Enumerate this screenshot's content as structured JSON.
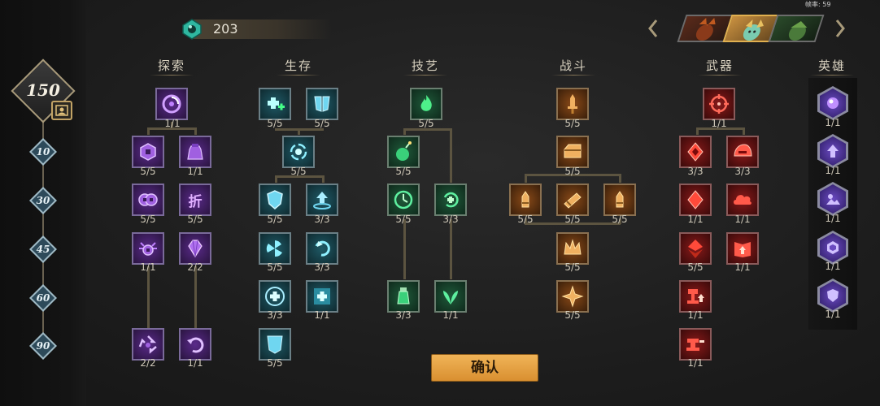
{
  "currency": {
    "icon": "gem-icon",
    "value": "203"
  },
  "fps_label": "帧率: 59",
  "player_level": "150",
  "level_milestones": [
    "10",
    "30",
    "45",
    "60",
    "90"
  ],
  "columns": [
    {
      "id": "explore",
      "title": "探索"
    },
    {
      "id": "survive",
      "title": "生存"
    },
    {
      "id": "craft",
      "title": "技艺"
    },
    {
      "id": "combat",
      "title": "战斗"
    },
    {
      "id": "weapon",
      "title": "武器"
    },
    {
      "id": "hero",
      "title": "英雄"
    }
  ],
  "nodes": {
    "explore_1": {
      "icon": "vortex-icon",
      "count": "1/1",
      "color": "purple"
    },
    "explore_2a": {
      "icon": "coin-icon",
      "count": "5/5",
      "color": "purple"
    },
    "explore_2b": {
      "icon": "bag-icon",
      "count": "1/1",
      "color": "purple"
    },
    "explore_3a": {
      "icon": "coins-icon",
      "count": "5/5",
      "color": "purple"
    },
    "explore_3b": {
      "icon": "discount-icon",
      "count": "5/5",
      "color": "purple",
      "glyph": "折"
    },
    "explore_4a": {
      "icon": "coin-rays-icon",
      "count": "1/1",
      "color": "purple"
    },
    "explore_4b": {
      "icon": "crystal-icon",
      "count": "2/2",
      "color": "purple"
    },
    "explore_5a": {
      "icon": "recycle-icon",
      "count": "2/2",
      "color": "purple"
    },
    "explore_5b": {
      "icon": "return-icon",
      "count": "1/1",
      "color": "purple"
    },
    "survive_1a": {
      "icon": "heal-plus-icon",
      "count": "5/5",
      "color": "teal"
    },
    "survive_1b": {
      "icon": "armor-icon",
      "count": "5/5",
      "color": "teal"
    },
    "survive_2": {
      "icon": "regen-icon",
      "count": "5/5",
      "color": "teal"
    },
    "survive_3a": {
      "icon": "shield-icon",
      "count": "5/5",
      "color": "teal"
    },
    "survive_3b": {
      "icon": "heal-up-icon",
      "count": "3/3",
      "color": "teal"
    },
    "survive_4a": {
      "icon": "spin-icon",
      "count": "5/5",
      "color": "teal"
    },
    "survive_4b": {
      "icon": "swirl-icon",
      "count": "3/3",
      "color": "teal"
    },
    "survive_5a": {
      "icon": "heal-circle-icon",
      "count": "3/3",
      "color": "teal"
    },
    "survive_5b": {
      "icon": "heal-box-icon",
      "count": "1/1",
      "color": "teal"
    },
    "survive_6": {
      "icon": "banner-icon",
      "count": "5/5",
      "color": "teal"
    },
    "craft_1": {
      "icon": "flame-icon",
      "count": "5/5",
      "color": "green"
    },
    "craft_2a": {
      "icon": "bomb-icon",
      "count": "5/5",
      "color": "green"
    },
    "craft_3a": {
      "icon": "clock-icon",
      "count": "5/5",
      "color": "green"
    },
    "craft_3b": {
      "icon": "heal-spin-icon",
      "count": "3/3",
      "color": "green"
    },
    "craft_4a": {
      "icon": "potion-icon",
      "count": "3/3",
      "color": "green"
    },
    "craft_4b": {
      "icon": "leaf-icon",
      "count": "1/1",
      "color": "green"
    },
    "combat_1": {
      "icon": "sword-icon",
      "count": "5/5",
      "color": "orange"
    },
    "combat_2": {
      "icon": "chest-icon",
      "count": "5/5",
      "color": "orange"
    },
    "combat_3a": {
      "icon": "bullet-icon",
      "count": "5/5",
      "color": "orange"
    },
    "combat_3b": {
      "icon": "ammo-icon",
      "count": "5/5",
      "color": "orange"
    },
    "combat_3c": {
      "icon": "bullet-icon",
      "count": "5/5",
      "color": "orange"
    },
    "combat_4": {
      "icon": "crown-icon",
      "count": "5/5",
      "color": "orange"
    },
    "combat_5": {
      "icon": "star-icon",
      "count": "5/5",
      "color": "orange"
    },
    "weapon_1": {
      "icon": "crosshair-icon",
      "count": "1/1",
      "color": "red"
    },
    "weapon_2a": {
      "icon": "gem-red-icon",
      "count": "3/3",
      "color": "red"
    },
    "weapon_2b": {
      "icon": "helmet-icon",
      "count": "3/3",
      "color": "red"
    },
    "weapon_3a": {
      "icon": "diamond-icon",
      "count": "1/1",
      "color": "red"
    },
    "weapon_3b": {
      "icon": "cloud-icon",
      "count": "1/1",
      "color": "red"
    },
    "weapon_4a": {
      "icon": "gem-split-icon",
      "count": "5/5",
      "color": "red"
    },
    "weapon_4b": {
      "icon": "book-up-icon",
      "count": "1/1",
      "color": "red"
    },
    "weapon_5": {
      "icon": "anvil-up-icon",
      "count": "1/1",
      "color": "red"
    },
    "weapon_6": {
      "icon": "forge-icon",
      "count": "1/1",
      "color": "red"
    },
    "hero_1": {
      "icon": "orb-icon",
      "count": "1/1"
    },
    "hero_2": {
      "icon": "up-arrow-icon",
      "count": "1/1"
    },
    "hero_3": {
      "icon": "landscape-icon",
      "count": "1/1"
    },
    "hero_4": {
      "icon": "gem-hex-icon",
      "count": "1/1"
    },
    "hero_5": {
      "icon": "shield-hex-icon",
      "count": "1/1"
    }
  },
  "confirm_label": "确认"
}
